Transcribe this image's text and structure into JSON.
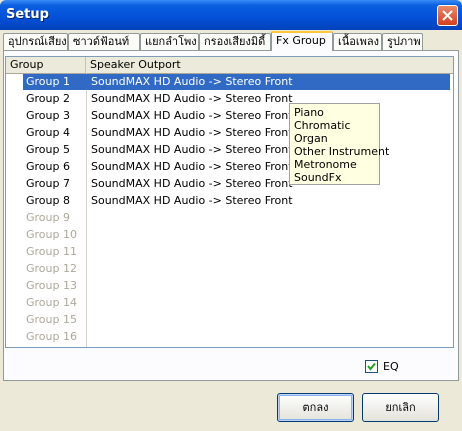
{
  "window": {
    "title": "Setup"
  },
  "tabs": [
    "อุปกรณ์เสียง",
    "ซาวด์ฟ้อนท์",
    "แยกลำโพง",
    "กรองเสียงมิดี้",
    "Fx Group",
    "เนื้อเพลง",
    "รูปภาพ"
  ],
  "active_tab": "Fx Group",
  "table": {
    "columns": [
      "Group",
      "Speaker Outport"
    ],
    "rows": [
      {
        "group": "Group 1",
        "speaker": "SoundMAX HD Audio -> Stereo Front",
        "selected": true
      },
      {
        "group": "Group 2",
        "speaker": "SoundMAX HD Audio -> Stereo Front"
      },
      {
        "group": "Group 3",
        "speaker": "SoundMAX HD Audio -> Stereo Front"
      },
      {
        "group": "Group 4",
        "speaker": "SoundMAX HD Audio -> Stereo Front"
      },
      {
        "group": "Group 5",
        "speaker": "SoundMAX HD Audio -> Stereo Front"
      },
      {
        "group": "Group 6",
        "speaker": "SoundMAX HD Audio -> Stereo Front"
      },
      {
        "group": "Group 7",
        "speaker": "SoundMAX HD Audio -> Stereo Front"
      },
      {
        "group": "Group 8",
        "speaker": "SoundMAX HD Audio -> Stereo Front"
      },
      {
        "group": "Group 9",
        "speaker": "",
        "disabled": true
      },
      {
        "group": "Group 10",
        "speaker": "",
        "disabled": true
      },
      {
        "group": "Group 11",
        "speaker": "",
        "disabled": true
      },
      {
        "group": "Group 12",
        "speaker": "",
        "disabled": true
      },
      {
        "group": "Group 13",
        "speaker": "",
        "disabled": true
      },
      {
        "group": "Group 14",
        "speaker": "",
        "disabled": true
      },
      {
        "group": "Group 15",
        "speaker": "",
        "disabled": true
      },
      {
        "group": "Group 16",
        "speaker": "",
        "disabled": true
      }
    ]
  },
  "popup": {
    "items": [
      "Piano",
      "Chromatic",
      "Organ",
      "Other Instrument",
      "Metronome",
      "SoundFx"
    ]
  },
  "eq": {
    "label": "EQ",
    "checked": true
  },
  "buttons": {
    "ok": "ตกลง",
    "cancel": "ยกเลิก"
  }
}
